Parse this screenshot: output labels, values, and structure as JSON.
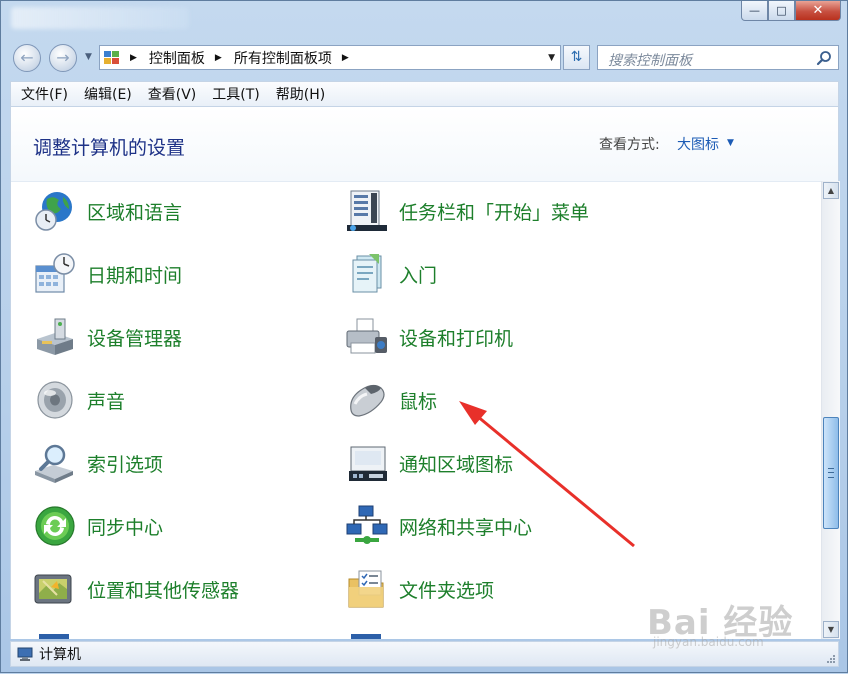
{
  "window": {
    "minimize": "—",
    "maximize": "□",
    "close": "✕"
  },
  "address": {
    "crumbs": [
      "控制面板",
      "所有控制面板项"
    ],
    "separator": "▶",
    "search_placeholder": "搜索控制面板"
  },
  "menu": [
    "文件(F)",
    "编辑(E)",
    "查看(V)",
    "工具(T)",
    "帮助(H)"
  ],
  "header": {
    "title": "调整计算机的设置",
    "view_label": "查看方式:",
    "view_value": "大图标"
  },
  "items_left": [
    {
      "label": "区域和语言",
      "icon": "globe-clock-icon"
    },
    {
      "label": "日期和时间",
      "icon": "calendar-clock-icon"
    },
    {
      "label": "设备管理器",
      "icon": "device-manager-icon"
    },
    {
      "label": "声音",
      "icon": "speaker-icon"
    },
    {
      "label": "索引选项",
      "icon": "index-magnifier-icon"
    },
    {
      "label": "同步中心",
      "icon": "sync-icon"
    },
    {
      "label": "位置和其他传感器",
      "icon": "sensor-icon"
    }
  ],
  "items_right": [
    {
      "label": "任务栏和「开始」菜单",
      "icon": "taskbar-icon"
    },
    {
      "label": "入门",
      "icon": "getting-started-icon"
    },
    {
      "label": "设备和打印机",
      "icon": "printer-icon"
    },
    {
      "label": "鼠标",
      "icon": "mouse-icon"
    },
    {
      "label": "通知区域图标",
      "icon": "notification-area-icon"
    },
    {
      "label": "网络和共享中心",
      "icon": "network-icon"
    },
    {
      "label": "文件夹选项",
      "icon": "folder-options-icon"
    }
  ],
  "status": {
    "text": "计算机"
  },
  "watermark": {
    "text": "Bai 经验",
    "url": "jingyan.baidu.com"
  },
  "colors": {
    "link_green": "#1d7f2b",
    "title_blue": "#1e3287",
    "annotation_red": "#e8302a"
  }
}
